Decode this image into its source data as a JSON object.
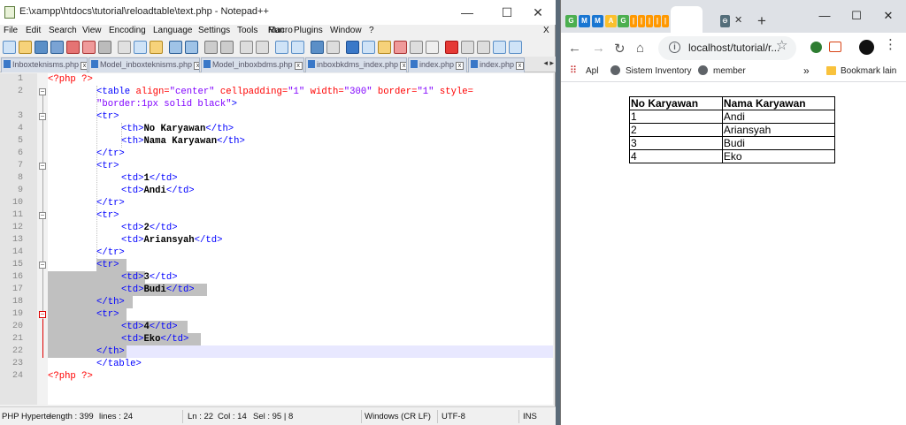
{
  "notepad": {
    "title": "E:\\xampp\\htdocs\\tutorial\\reloadtable\\text.php - Notepad++",
    "window_controls": {
      "minimize": "—",
      "maximize": "☐",
      "close": "✕"
    },
    "menu": [
      "File",
      "Edit",
      "Search",
      "View",
      "Encoding",
      "Language",
      "Settings",
      "Tools",
      "Macro",
      "Run",
      "Plugins",
      "Window",
      "?"
    ],
    "menu_close": "X",
    "tabs": [
      "Inboxteknisms.php",
      "Model_inboxteknisms.php",
      "Model_inboxbdms.php",
      "inboxbkdms_index.php",
      "index.php",
      "index.php"
    ],
    "tab_close": "x",
    "tab_scroll": "◂ ▸",
    "line_numbers": [
      "1",
      "2",
      "3",
      "4",
      "5",
      "6",
      "7",
      "8",
      "9",
      "10",
      "11",
      "12",
      "13",
      "14",
      "15",
      "16",
      "17",
      "18",
      "19",
      "20",
      "21",
      "22",
      "23",
      "24"
    ],
    "code": {
      "l1": "<?php ?>",
      "l2_tag_open": "<table",
      "l2_a1": " align=",
      "l2_v1": "\"center\"",
      "l2_a2": " cellpadding=",
      "l2_v2": "\"1\"",
      "l2_a3": " width=",
      "l2_v3": "\"300\"",
      "l2_a4": " border=",
      "l2_v4": "\"1\"",
      "l2_a5": " style=",
      "l2b_val": "\"border:1px solid black\"",
      "l2b_close": ">",
      "tr_open": "<tr>",
      "tr_close": "</tr>",
      "th_open": "<th>",
      "th_close": "</th>",
      "td_open": "<td>",
      "td_close": "</td>",
      "table_close": "</table>",
      "h1": "No Karyawan",
      "h2": "Nama Karyawan",
      "r1a": "1",
      "r1b": "Andi",
      "r2a": "2",
      "r2b": "Ariansyah",
      "r3a": "3",
      "r3b": "Budi",
      "r4a": "4",
      "r4b": "Eko",
      "l24": "<?php ?>"
    },
    "status": {
      "type": "PHP Hyperte",
      "length": "length : 399",
      "lines": "lines : 24",
      "ln": "Ln : 22",
      "col": "Col : 14",
      "sel": "Sel : 95 | 8",
      "eol": "Windows (CR LF)",
      "encoding": "UTF-8",
      "mode": "INS"
    }
  },
  "chrome": {
    "tab_favicons": [
      {
        "label": "G",
        "color": "#4caf50"
      },
      {
        "label": "M",
        "color": "#1976d2"
      },
      {
        "label": "M",
        "color": "#1976d2"
      },
      {
        "label": "A",
        "color": "#fbc02d"
      },
      {
        "label": "G",
        "color": "#4caf50"
      },
      {
        "label": "|",
        "color": "#ff9800"
      },
      {
        "label": "|",
        "color": "#ff9800"
      },
      {
        "label": "|",
        "color": "#ff9800"
      },
      {
        "label": "|",
        "color": "#ff9800"
      },
      {
        "label": "|",
        "color": "#ff9800"
      },
      {
        "label": "|",
        "color": "#ff9800"
      },
      {
        "label": "⊖",
        "color": "#546e7a"
      }
    ],
    "active_tab_close": "✕",
    "new_tab": "+",
    "window_controls": {
      "minimize": "—",
      "maximize": "☐",
      "close": "✕"
    },
    "nav": {
      "back": "←",
      "forward": "→",
      "reload": "↻",
      "home": "⌂"
    },
    "url": "localhost/tutorial/r...",
    "star": "☆",
    "bookmarks": {
      "apps": "Apl",
      "b1": "Sistem Inventory",
      "b2": "member",
      "more": "»",
      "other": "Bookmark lain"
    },
    "table": {
      "headers": [
        "No Karyawan",
        "Nama Karyawan"
      ],
      "rows": [
        [
          "1",
          "Andi"
        ],
        [
          "2",
          "Ariansyah"
        ],
        [
          "3",
          "Budi"
        ],
        [
          "4",
          "Eko"
        ]
      ]
    }
  },
  "colors": {
    "html_tag": "#0000ff",
    "html_attr": "#ff0000",
    "html_value": "#8000ff",
    "selection": "#c0c0c0",
    "current_line": "#e8e8ff"
  }
}
